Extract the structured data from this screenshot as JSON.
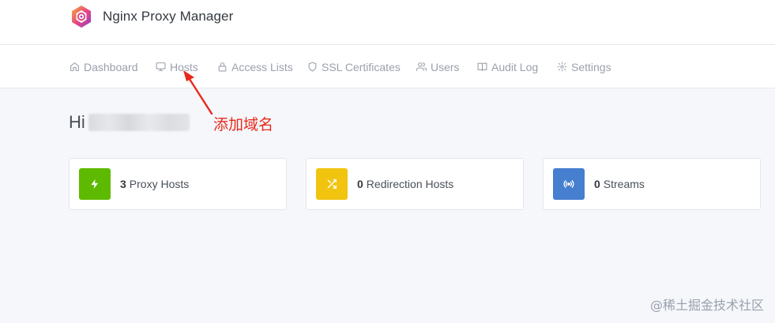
{
  "header": {
    "title": "Nginx Proxy Manager",
    "logo_icon": "npm-hexagon-logo-icon"
  },
  "nav": {
    "items": [
      {
        "label": "Dashboard",
        "icon": "home-icon"
      },
      {
        "label": "Hosts",
        "icon": "monitor-icon"
      },
      {
        "label": "Access Lists",
        "icon": "lock-icon"
      },
      {
        "label": "SSL Certificates",
        "icon": "shield-icon"
      },
      {
        "label": "Users",
        "icon": "users-icon"
      },
      {
        "label": "Audit Log",
        "icon": "book-icon"
      },
      {
        "label": "Settings",
        "icon": "gear-icon"
      }
    ]
  },
  "greeting": {
    "text": "Hi"
  },
  "annotation": {
    "text": "添加域名",
    "color": "#e8291c"
  },
  "cards": [
    {
      "count": "3",
      "label": "Proxy Hosts",
      "icon": "lightning-icon",
      "color": "#5eba00"
    },
    {
      "count": "0",
      "label": "Redirection Hosts",
      "icon": "shuffle-icon",
      "color": "#f1c40f"
    },
    {
      "count": "0",
      "label": "Streams",
      "icon": "radio-icon",
      "color": "#467fcf"
    }
  ],
  "watermark": {
    "text": "@稀土掘金技术社区"
  }
}
